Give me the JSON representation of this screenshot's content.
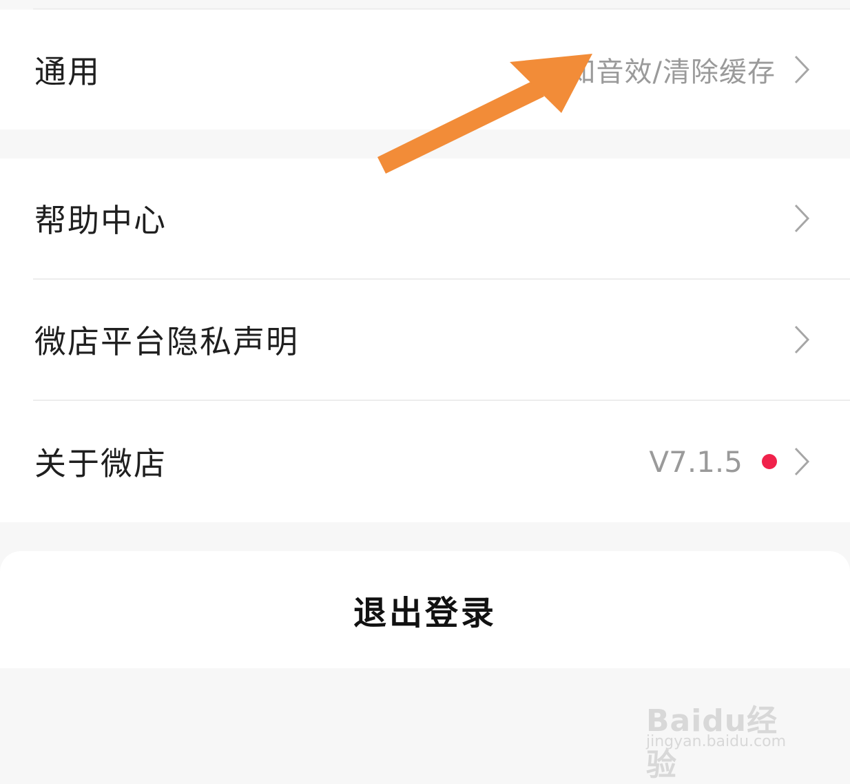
{
  "settings": {
    "general": {
      "label": "通用",
      "value": "通知音效/清除缓存"
    },
    "help": {
      "label": "帮助中心"
    },
    "privacy": {
      "label": "微店平台隐私声明"
    },
    "about": {
      "label": "关于微店",
      "version": "V7.1.5",
      "badge_color": "#f0224b"
    }
  },
  "logout": {
    "label": "退出登录"
  },
  "annotation": {
    "color": "#f28c38"
  },
  "watermark": {
    "logo": "Baidu经验",
    "url": "jingyan.baidu.com"
  },
  "icons": {
    "chevron": "chevron-right-icon",
    "arrow": "annotation-arrow"
  }
}
